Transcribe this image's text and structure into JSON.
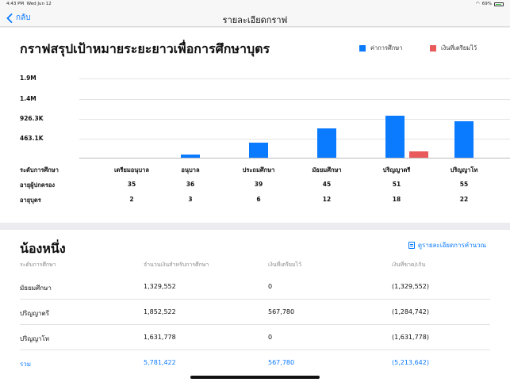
{
  "status": {
    "time": "4:43 PM",
    "date": "Wed Jun 12",
    "battery": "69%"
  },
  "nav": {
    "back": "กลับ",
    "title": "รายละเอียดกราฟ"
  },
  "chart_section": {
    "title": "กราฟสรุปเป้าหมายระยะยาวเพื่อการศึกษาบุตร",
    "row_labels": {
      "level": "ระดับการศึกษา",
      "parent_age": "อายุผู้ปกครอง",
      "child_age": "อายุบุตร"
    },
    "parent_ages": [
      "35",
      "36",
      "39",
      "45",
      "51",
      "55"
    ],
    "child_ages": [
      "2",
      "3",
      "6",
      "12",
      "18",
      "22"
    ]
  },
  "chart_data": {
    "type": "bar",
    "categories": [
      "เตรียมอนุบาล",
      "อนุบาล",
      "ประถมศึกษา",
      "มัธยมศึกษา",
      "ปริญญาตรี",
      "ปริญญาโท"
    ],
    "series": [
      {
        "name": "ค่าการศึกษา",
        "color": "#0a7aff",
        "values": [
          0,
          70000,
          370000,
          710000,
          1010000,
          880000
        ]
      },
      {
        "name": "เงินที่เตรียมไว้",
        "color": "#e95b5b",
        "values": [
          0,
          0,
          0,
          0,
          160000,
          0
        ]
      }
    ],
    "yticks": [
      "463.1K",
      "926.3K",
      "1.4M",
      "1.9M"
    ],
    "ytick_values": [
      463100,
      926300,
      1400000,
      1900000
    ],
    "ylim": [
      0,
      1900000
    ],
    "legend_position": "top-right",
    "grid": true
  },
  "detail": {
    "name": "น้องหนึ่ง",
    "link": "ดูรายละเอียดการคำนวณ",
    "headers": [
      "ระดับการศึกษา",
      "จำนวนเงินสำหรับการศึกษา",
      "เงินที่เตรียมไว้",
      "เงินที่ขาด/เกิน"
    ],
    "rows": [
      [
        "มัธยมศึกษา",
        "1,329,552",
        "0",
        "(1,329,552)"
      ],
      [
        "ปริญญาตรี",
        "1,852,522",
        "567,780",
        "(1,284,742)"
      ],
      [
        "ปริญญาโท",
        "1,631,778",
        "0",
        "(1,631,778)"
      ]
    ],
    "total": [
      "รวม",
      "5,781,422",
      "567,780",
      "(5,213,642)"
    ]
  }
}
